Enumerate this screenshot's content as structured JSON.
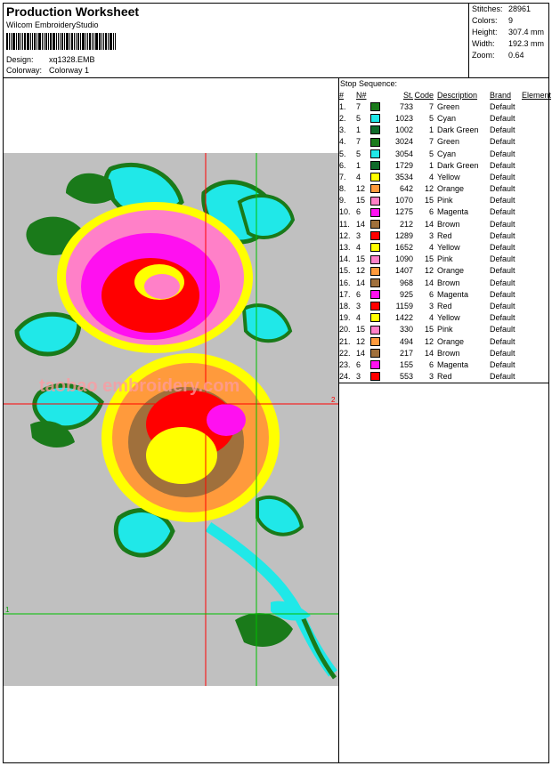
{
  "header": {
    "title": "Production Worksheet",
    "software": "Wilcom  EmbroideryStudio",
    "design_label": "Design:",
    "design_value": "xq1328.EMB",
    "colorway_label": "Colorway:",
    "colorway_value": "Colorway 1"
  },
  "stats": {
    "stitches_label": "Stitches:",
    "stitches_value": "28961",
    "colors_label": "Colors:",
    "colors_value": "9",
    "height_label": "Height:",
    "height_value": "307.4 mm",
    "width_label": "Width:",
    "width_value": "192.3 mm",
    "zoom_label": "Zoom:",
    "zoom_value": "0.64"
  },
  "canvas": {
    "background": "#c0c0c0",
    "watermark": "taobao embroidery.com",
    "marker_1": "1",
    "marker_2": "2"
  },
  "sequence": {
    "title": "Stop Sequence:",
    "headers": {
      "idx": "#",
      "n": "N#",
      "st": "St.",
      "code": "Code",
      "desc": "Description",
      "brand": "Brand",
      "elem": "Element"
    },
    "rows": [
      {
        "idx": "1.",
        "n": "7",
        "color": "#1a7a1a",
        "st": "733",
        "code": "7",
        "desc": "Green",
        "brand": "Default"
      },
      {
        "idx": "2.",
        "n": "5",
        "color": "#20e8e8",
        "st": "1023",
        "code": "5",
        "desc": "Cyan",
        "brand": "Default"
      },
      {
        "idx": "3.",
        "n": "1",
        "color": "#0f6b2a",
        "st": "1002",
        "code": "1",
        "desc": "Dark Green",
        "brand": "Default"
      },
      {
        "idx": "4.",
        "n": "7",
        "color": "#1a7a1a",
        "st": "3024",
        "code": "7",
        "desc": "Green",
        "brand": "Default"
      },
      {
        "idx": "5.",
        "n": "5",
        "color": "#20e8e8",
        "st": "3054",
        "code": "5",
        "desc": "Cyan",
        "brand": "Default"
      },
      {
        "idx": "6.",
        "n": "1",
        "color": "#0f6b2a",
        "st": "1729",
        "code": "1",
        "desc": "Dark Green",
        "brand": "Default"
      },
      {
        "idx": "7.",
        "n": "4",
        "color": "#ffff00",
        "st": "3534",
        "code": "4",
        "desc": "Yellow",
        "brand": "Default"
      },
      {
        "idx": "8.",
        "n": "12",
        "color": "#ff9a3c",
        "st": "642",
        "code": "12",
        "desc": "Orange",
        "brand": "Default"
      },
      {
        "idx": "9.",
        "n": "15",
        "color": "#ff80c8",
        "st": "1070",
        "code": "15",
        "desc": "Pink",
        "brand": "Default"
      },
      {
        "idx": "10.",
        "n": "6",
        "color": "#ff10f0",
        "st": "1275",
        "code": "6",
        "desc": "Magenta",
        "brand": "Default"
      },
      {
        "idx": "11.",
        "n": "14",
        "color": "#a0703c",
        "st": "212",
        "code": "14",
        "desc": "Brown",
        "brand": "Default"
      },
      {
        "idx": "12.",
        "n": "3",
        "color": "#ff0000",
        "st": "1289",
        "code": "3",
        "desc": "Red",
        "brand": "Default"
      },
      {
        "idx": "13.",
        "n": "4",
        "color": "#ffff00",
        "st": "1652",
        "code": "4",
        "desc": "Yellow",
        "brand": "Default"
      },
      {
        "idx": "14.",
        "n": "15",
        "color": "#ff80c8",
        "st": "1090",
        "code": "15",
        "desc": "Pink",
        "brand": "Default"
      },
      {
        "idx": "15.",
        "n": "12",
        "color": "#ff9a3c",
        "st": "1407",
        "code": "12",
        "desc": "Orange",
        "brand": "Default"
      },
      {
        "idx": "16.",
        "n": "14",
        "color": "#a0703c",
        "st": "968",
        "code": "14",
        "desc": "Brown",
        "brand": "Default"
      },
      {
        "idx": "17.",
        "n": "6",
        "color": "#ff10f0",
        "st": "925",
        "code": "6",
        "desc": "Magenta",
        "brand": "Default"
      },
      {
        "idx": "18.",
        "n": "3",
        "color": "#ff0000",
        "st": "1159",
        "code": "3",
        "desc": "Red",
        "brand": "Default"
      },
      {
        "idx": "19.",
        "n": "4",
        "color": "#ffff00",
        "st": "1422",
        "code": "4",
        "desc": "Yellow",
        "brand": "Default"
      },
      {
        "idx": "20.",
        "n": "15",
        "color": "#ff80c8",
        "st": "330",
        "code": "15",
        "desc": "Pink",
        "brand": "Default"
      },
      {
        "idx": "21.",
        "n": "12",
        "color": "#ff9a3c",
        "st": "494",
        "code": "12",
        "desc": "Orange",
        "brand": "Default"
      },
      {
        "idx": "22.",
        "n": "14",
        "color": "#a0703c",
        "st": "217",
        "code": "14",
        "desc": "Brown",
        "brand": "Default"
      },
      {
        "idx": "23.",
        "n": "6",
        "color": "#ff10f0",
        "st": "155",
        "code": "6",
        "desc": "Magenta",
        "brand": "Default"
      },
      {
        "idx": "24.",
        "n": "3",
        "color": "#ff0000",
        "st": "553",
        "code": "3",
        "desc": "Red",
        "brand": "Default"
      }
    ]
  }
}
